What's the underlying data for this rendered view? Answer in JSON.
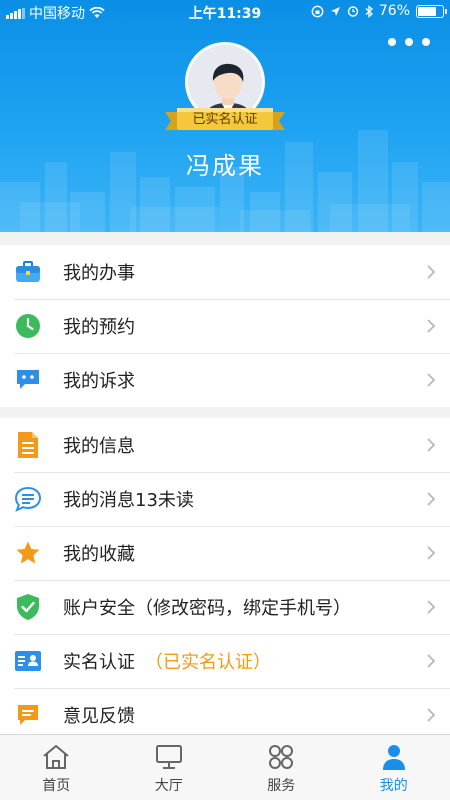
{
  "status_bar": {
    "carrier": "中国移动",
    "time": "上午11:39",
    "battery": "76%",
    "battery_level": 0.76
  },
  "profile": {
    "badge": "已实名认证",
    "name": "冯成果"
  },
  "menu_group_1": [
    {
      "label": "我的办事",
      "icon": "briefcase-icon",
      "color": "#3a9df0"
    },
    {
      "label": "我的预约",
      "icon": "clock-icon",
      "color": "#3dbb5c"
    },
    {
      "label": "我的诉求",
      "icon": "chat-bubbles-icon",
      "color": "#2f8fe6"
    }
  ],
  "menu_group_2": [
    {
      "label": "我的信息",
      "icon": "document-icon",
      "color": "#f29a18"
    },
    {
      "label": "我的消息13未读",
      "icon": "message-icon",
      "color": "#2f8fe6"
    },
    {
      "label": "我的收藏",
      "icon": "star-icon",
      "color": "#f29a18"
    },
    {
      "label": "账户安全（修改密码，绑定手机号）",
      "icon": "shield-check-icon",
      "color": "#3dbb5c"
    },
    {
      "label": "实名认证",
      "extra": "（已实名认证）",
      "icon": "id-card-icon",
      "color": "#2f8fe6"
    },
    {
      "label": "意见反馈",
      "icon": "feedback-icon",
      "color": "#f29a18"
    }
  ],
  "tabs": [
    {
      "label": "首页",
      "icon": "home-icon",
      "active": false
    },
    {
      "label": "大厅",
      "icon": "monitor-icon",
      "active": false
    },
    {
      "label": "服务",
      "icon": "grid-icon",
      "active": false
    },
    {
      "label": "我的",
      "icon": "person-icon",
      "active": true
    }
  ],
  "colors": {
    "header_blue": "#1a9bf0",
    "accent_orange": "#f29a18",
    "accent_green": "#3dbb5c",
    "tab_active": "#1a8fe8"
  }
}
